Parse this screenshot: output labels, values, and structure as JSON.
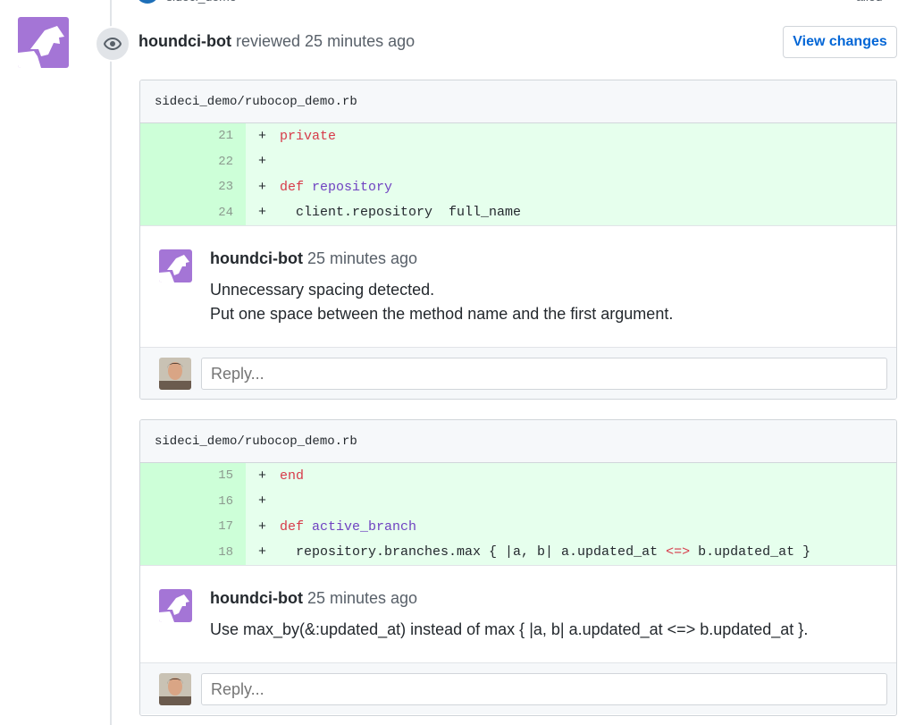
{
  "top": {
    "repo_fragment": "sideci_demo",
    "status_fragment": "ailed"
  },
  "review": {
    "author": "houndci-bot",
    "action": "reviewed",
    "time": "25 minutes ago",
    "view_changes_label": "View changes"
  },
  "threads": [
    {
      "file": "sideci_demo/rubocop_demo.rb",
      "lines": [
        {
          "num": "21",
          "sign": "+",
          "code": "private"
        },
        {
          "num": "22",
          "sign": "+",
          "code": ""
        },
        {
          "num": "23",
          "sign": "+",
          "keyword": "def",
          "name": "repository"
        },
        {
          "num": "24",
          "sign": "+",
          "code": "  client.repository  full_name"
        }
      ],
      "comment": {
        "author": "houndci-bot",
        "time": "25 minutes ago",
        "body": [
          "Unnecessary spacing detected.",
          "Put one space between the method name and the first argument."
        ]
      },
      "reply_placeholder": "Reply..."
    },
    {
      "file": "sideci_demo/rubocop_demo.rb",
      "lines": [
        {
          "num": "15",
          "sign": "+",
          "code": "end"
        },
        {
          "num": "16",
          "sign": "+",
          "code": ""
        },
        {
          "num": "17",
          "sign": "+",
          "keyword": "def",
          "name": "active_branch"
        },
        {
          "num": "18",
          "sign": "+",
          "code_pre": "  repository.branches.max { |a, b| a.updated_at ",
          "op": "<=>",
          "code_post": " b.updated_at }"
        }
      ],
      "comment": {
        "author": "houndci-bot",
        "time": "25 minutes ago",
        "body": [
          "Use max_by(&:updated_at) instead of max { |a, b| a.updated_at <=> b.updated_at }."
        ]
      },
      "reply_placeholder": "Reply..."
    }
  ],
  "colors": {
    "bot_avatar": "#a475d6",
    "added_bg": "#e6ffed",
    "added_num_bg": "#cdffd8",
    "link": "#0366d6",
    "keyword": "#d73a49",
    "function": "#6f42c1"
  },
  "icons": {
    "event": "eye-icon",
    "bot_avatar": "houndci-dog-icon",
    "user_avatar": "user-photo-avatar"
  }
}
